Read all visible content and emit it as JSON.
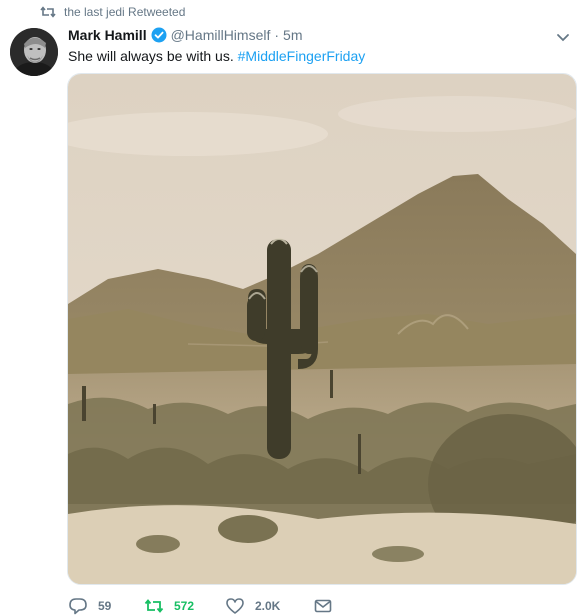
{
  "retweet_context": {
    "text": "the last jedi Retweeted",
    "icon": "retweet-icon"
  },
  "tweet": {
    "author": {
      "display_name": "Mark Hamill",
      "handle": "@HamillHimself",
      "verified_icon": "verified-badge-icon",
      "avatar_icon": "avatar"
    },
    "separator": "·",
    "timestamp": "5m",
    "text": "She will always be with us.",
    "hashtag": "#MiddleFingerFriday",
    "media_description": "photo-desert-saguaro-cactus-mountain"
  },
  "actions": {
    "reply": {
      "icon": "reply-icon",
      "count": "59"
    },
    "retweet": {
      "icon": "retweet-icon",
      "count": "572"
    },
    "like": {
      "icon": "heart-icon",
      "count": "2.0K"
    },
    "message": {
      "icon": "envelope-icon"
    }
  },
  "colors": {
    "accent": "#1da1f2",
    "retweet_green": "#17bf63",
    "muted": "#657786",
    "text": "#14171a",
    "border": "#e1e8ed"
  }
}
